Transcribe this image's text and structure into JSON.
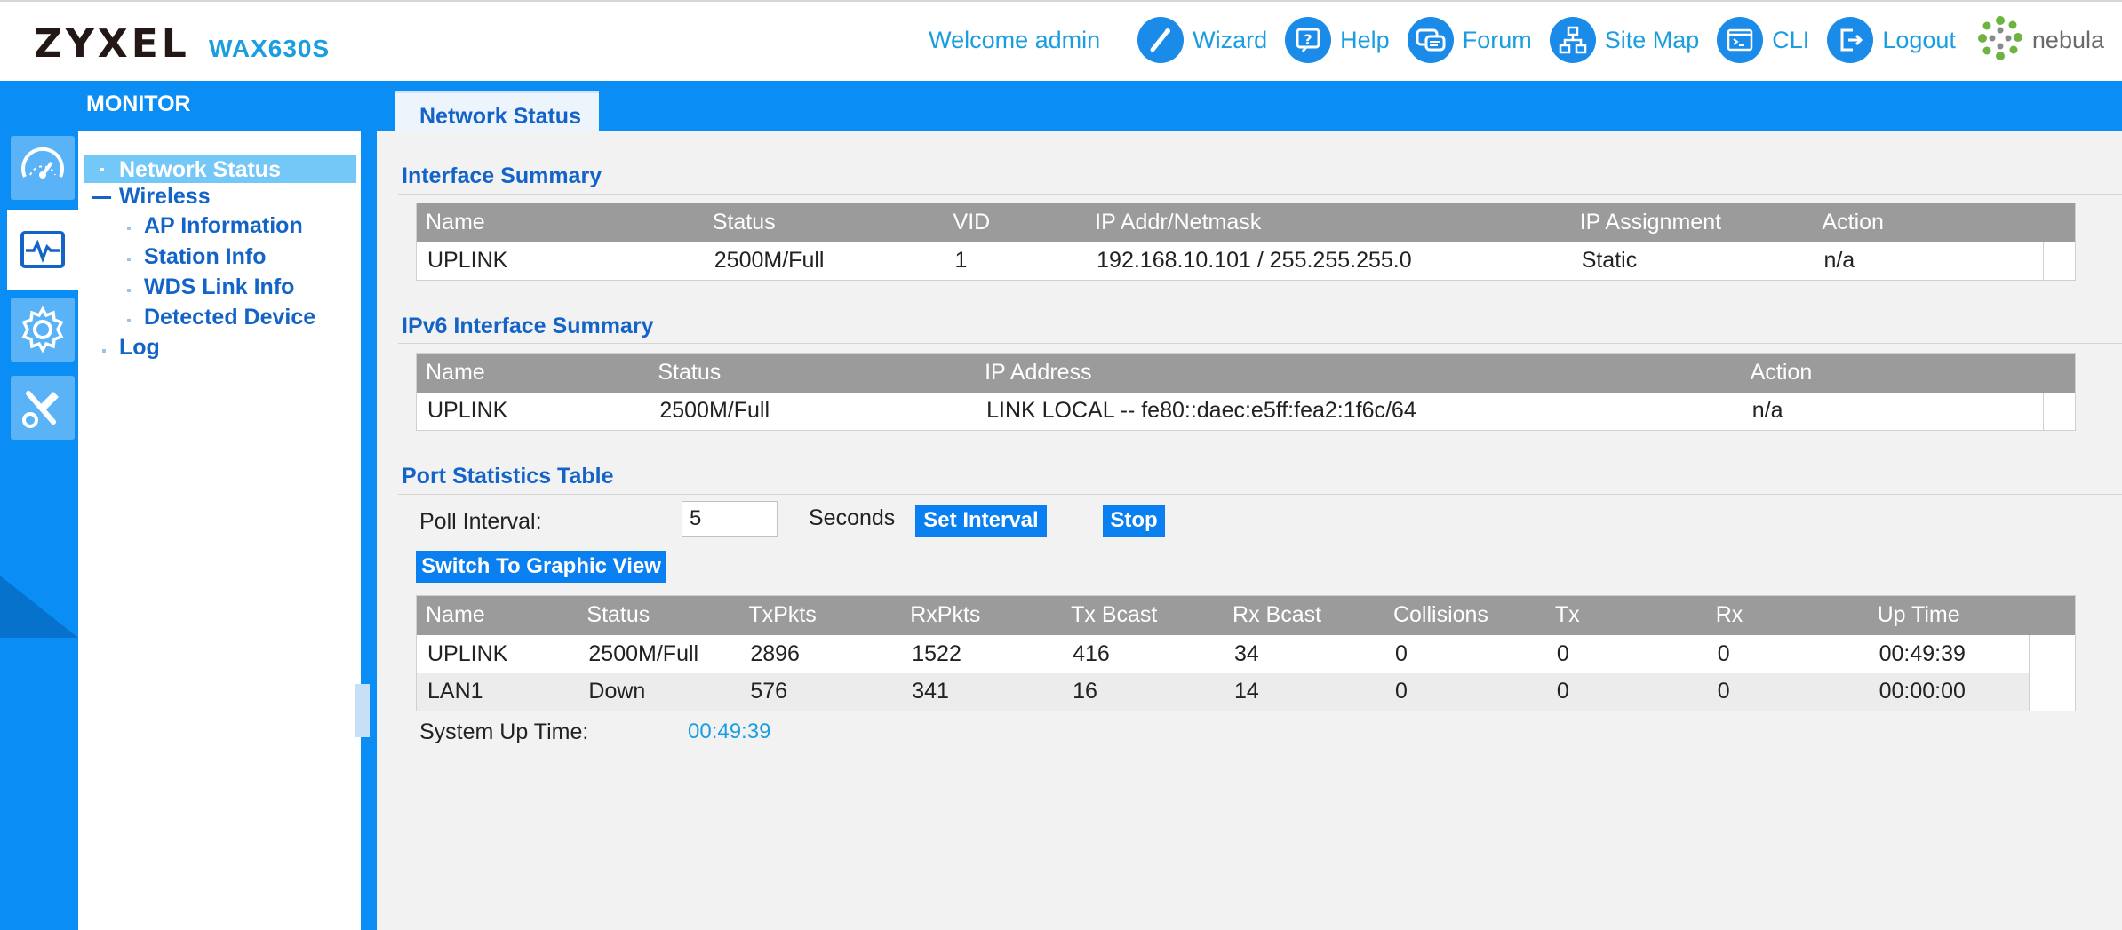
{
  "header": {
    "brand": "ZYXEL",
    "model": "WAX630S",
    "welcome": "Welcome admin",
    "nav": [
      {
        "label": "Wizard",
        "icon": "wizard-icon"
      },
      {
        "label": "Help",
        "icon": "help-icon"
      },
      {
        "label": "Forum",
        "icon": "forum-icon"
      },
      {
        "label": "Site Map",
        "icon": "sitemap-icon"
      },
      {
        "label": "CLI",
        "icon": "cli-icon"
      },
      {
        "label": "Logout",
        "icon": "logout-icon"
      }
    ],
    "nebula": "nebula"
  },
  "topbar": {
    "section": "MONITOR",
    "tab": "Network Status"
  },
  "rail": [
    {
      "icon": "dashboard-icon"
    },
    {
      "icon": "monitor-icon",
      "active": true
    },
    {
      "icon": "configuration-icon"
    },
    {
      "icon": "maintenance-icon"
    }
  ],
  "menu": {
    "network_status": "Network Status",
    "wireless": "Wireless",
    "ap_information": "AP Information",
    "station_info": "Station Info",
    "wds_link_info": "WDS Link Info",
    "detected_device": "Detected Device",
    "log": "Log"
  },
  "interface_summary": {
    "title": "Interface Summary",
    "columns": [
      "Name",
      "Status",
      "VID",
      "IP Addr/Netmask",
      "IP Assignment",
      "Action"
    ],
    "rows": [
      [
        "UPLINK",
        "2500M/Full",
        "1",
        "192.168.10.101 / 255.255.255.0",
        "Static",
        "n/a"
      ]
    ]
  },
  "ipv6_summary": {
    "title": "IPv6 Interface Summary",
    "columns": [
      "Name",
      "Status",
      "IP Address",
      "Action"
    ],
    "rows": [
      [
        "UPLINK",
        "2500M/Full",
        "LINK LOCAL -- fe80::daec:e5ff:fea2:1f6c/64",
        "n/a"
      ]
    ]
  },
  "port_stats": {
    "title": "Port Statistics Table",
    "poll_label": "Poll Interval:",
    "poll_value": "5",
    "seconds_label": "Seconds",
    "set_interval": "Set Interval",
    "stop": "Stop",
    "graphic_view": "Switch To Graphic View",
    "columns": [
      "Name",
      "Status",
      "TxPkts",
      "RxPkts",
      "Tx Bcast",
      "Rx Bcast",
      "Collisions",
      "Tx",
      "Rx",
      "Up Time"
    ],
    "rows": [
      [
        "UPLINK",
        "2500M/Full",
        "2896",
        "1522",
        "416",
        "34",
        "0",
        "0",
        "0",
        "00:49:39"
      ],
      [
        "LAN1",
        "Down",
        "576",
        "341",
        "16",
        "14",
        "0",
        "0",
        "0",
        "00:00:00"
      ]
    ],
    "system_uptime_label": "System Up Time:",
    "system_uptime": "00:49:39"
  },
  "colors": {
    "accent": "#0a8ef5",
    "link": "#1464c8",
    "highlight": "#1a9ee0"
  }
}
